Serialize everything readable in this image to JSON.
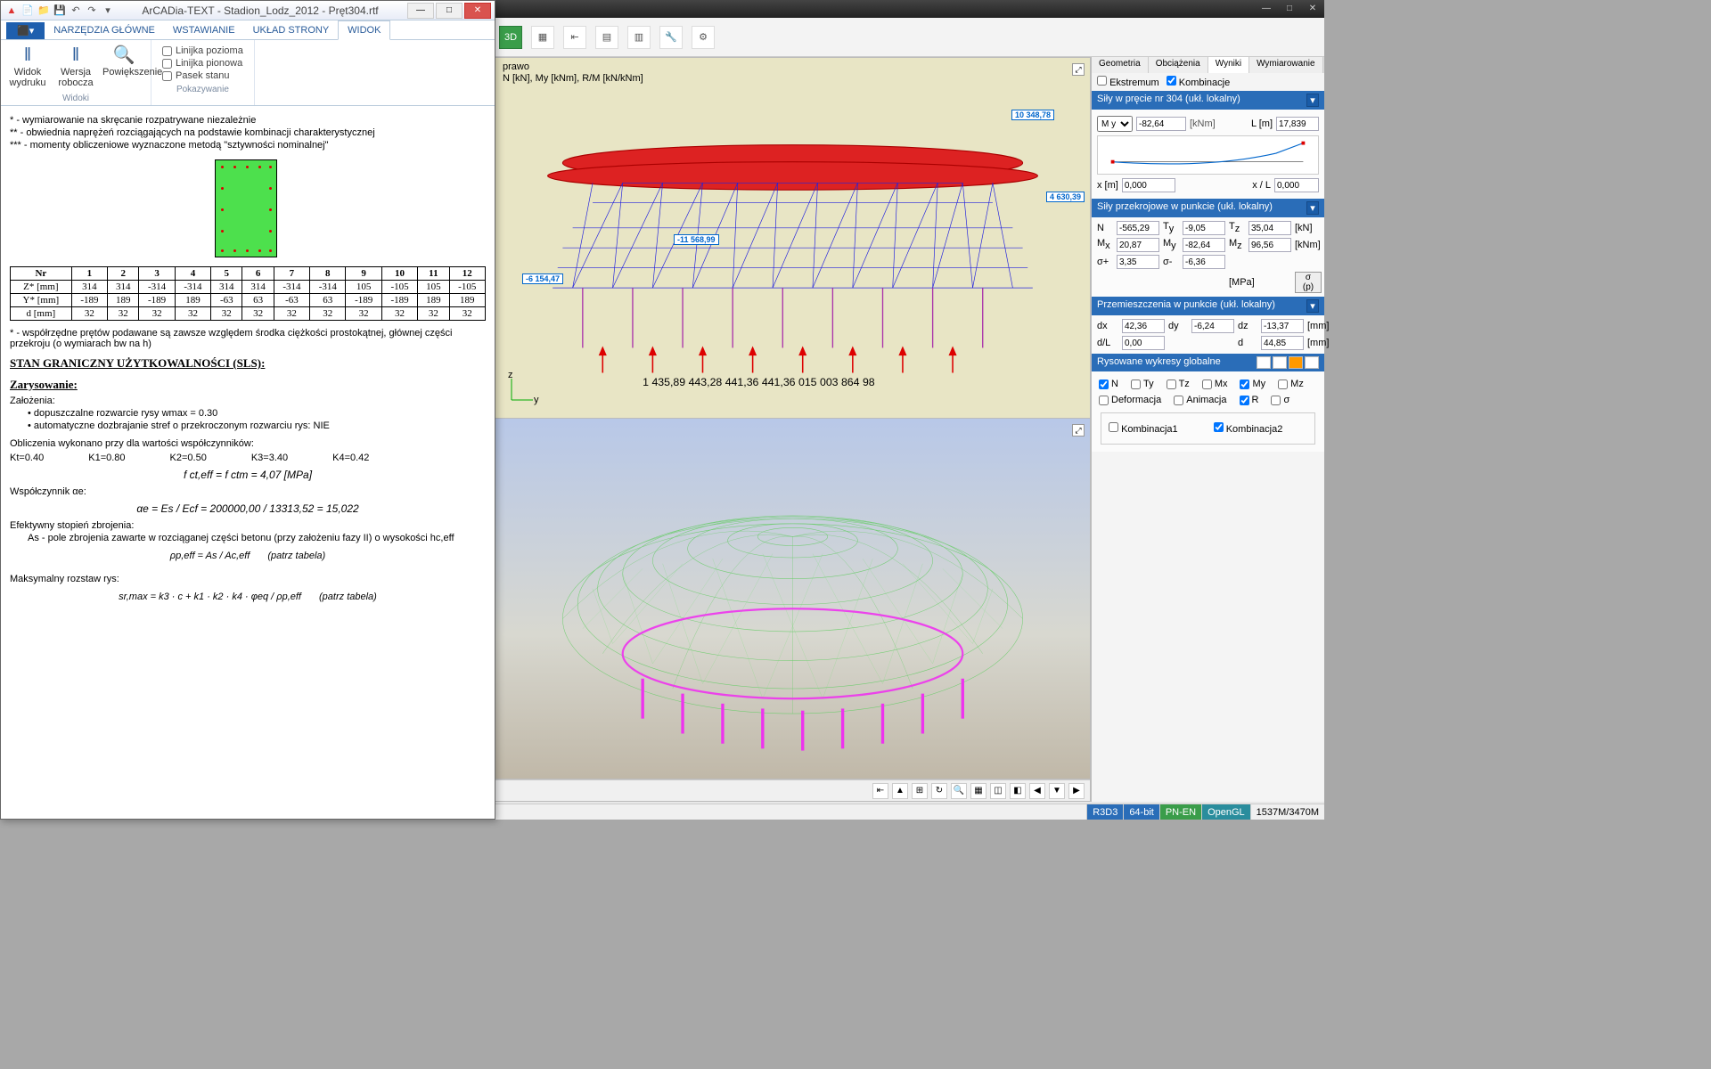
{
  "arcadia": {
    "title": "ArCADia-TEXT - Stadion_Lodz_2012 - Pręt304.rtf",
    "tabs": {
      "file": "⬛▾",
      "narzedzia": "NARZĘDZIA GŁÓWNE",
      "wstawianie": "WSTAWIANIE",
      "uklad": "UKŁAD STRONY",
      "widok": "WIDOK"
    },
    "ribbon": {
      "widok_wydruku": "Widok wydruku",
      "wersja_robocza": "Wersja robocza",
      "powiekszenie": "Powiększenie",
      "widoki_label": "Widoki",
      "linijka_pozioma": "Linijka pozioma",
      "linijka_pionowa": "Linijka pionowa",
      "pasek_stanu": "Pasek stanu",
      "pokazywanie_label": "Pokazywanie"
    },
    "doc": {
      "note1": "* - wymiarowanie na skręcanie rozpatrywane niezależnie",
      "note2": "** - obwiednia naprężeń rozciągających na podstawie kombinacji charakterystycznej",
      "note3": "*** - momenty obliczeniowe wyznaczone metodą \"sztywności nominalnej\"",
      "table": {
        "headers": [
          "Nr",
          "1",
          "2",
          "3",
          "4",
          "5",
          "6",
          "7",
          "8",
          "9",
          "10",
          "11",
          "12"
        ],
        "rows": [
          [
            "Z* [mm]",
            "314",
            "314",
            "-314",
            "-314",
            "314",
            "314",
            "-314",
            "-314",
            "105",
            "-105",
            "105",
            "-105"
          ],
          [
            "Y* [mm]",
            "-189",
            "189",
            "-189",
            "189",
            "-63",
            "63",
            "-63",
            "63",
            "-189",
            "-189",
            "189",
            "189"
          ],
          [
            "d [mm]",
            "32",
            "32",
            "32",
            "32",
            "32",
            "32",
            "32",
            "32",
            "32",
            "32",
            "32",
            "32"
          ]
        ]
      },
      "note4": "* - współrzędne prętów podawane są zawsze względem środka ciężkości prostokątnej, głównej części przekroju (o wymiarach bw na h)",
      "sls_heading": "STAN GRANICZNY UŻYTKOWALNOŚCI (SLS):",
      "zarysowanie": "Zarysowanie:",
      "zalozenia": "Założenia:",
      "assum1": "dopuszczalne rozwarcie rysy wmax = 0.30",
      "assum2": "automatyczne dozbrajanie stref o przekroczonym rozwarciu rys: NIE",
      "coef_intro": "Obliczenia wykonano przy dla wartości współczynników:",
      "coefs": {
        "k1": "Kt=0.40",
        "k2": "K1=0.80",
        "k3": "K2=0.50",
        "k4": "K3=3.40",
        "k5": "K4=0.42"
      },
      "formula1": "f ct,eff = f ctm = 4,07 [MPa]",
      "alpha_label": "Współczynnik αe:",
      "formula2": "αe = Es / Ecf = 200000,00 / 13313,52 = 15,022",
      "eff_label": "Efektywny stopień zbrojenia:",
      "eff_desc": "As - pole zbrojenia zawarte w rozciąganej części betonu (przy założeniu fazy II) o wysokości hc,eff",
      "formula3": "ρp,eff = As / Ac,eff",
      "patrz": "(patrz tabela)",
      "max_label": "Maksymalny rozstaw rys:",
      "formula4": "sr,max = k3 · c + k1 · k2 · k4 · φeq / ρp,eff"
    }
  },
  "viewport": {
    "top_label1": "prawo",
    "top_label2": "N [kN], My [kNm], R/M [kN/kNm]",
    "axis_z": "z",
    "axis_y": "y",
    "tags": {
      "t1": "10 348,78",
      "t2": "4 630,39",
      "t3": "-11 568,99",
      "t4": "-6 154,47"
    }
  },
  "panel": {
    "tabs": {
      "geometria": "Geometria",
      "obciazenia": "Obciążenia",
      "wyniki": "Wyniki",
      "wymiarowanie": "Wymiarowanie"
    },
    "ekstremum": "Ekstremum",
    "kombinacje": "Kombinacje",
    "sily_header": "Siły w pręcie nr 304 (ukł. lokalny)",
    "My_val": "-82,64",
    "kNm": "[kNm]",
    "L_lbl": "L [m]",
    "L_val": "17,839",
    "x_lbl": "x [m]",
    "x_val": "0,000",
    "xL_lbl": "x / L",
    "xL_val": "0,000",
    "przekroj_header": "Siły przekrojowe w punkcie (ukł. lokalny)",
    "N": "-565,29",
    "Ty": "-9,05",
    "Tz": "35,04",
    "Mx": "20,87",
    "My": "-82,64",
    "Mz": "96,56",
    "sp": "3,35",
    "sm": "-6,36",
    "sigma_btn": "σ (p)",
    "kN": "[kN]",
    "MPa": "[MPa]",
    "przem_header": "Przemieszczenia w punkcie (ukł. lokalny)",
    "dx": "42,36",
    "dy": "-6,24",
    "dz": "-13,37",
    "dL": "0,00",
    "dblank": "44,85",
    "mm": "[mm]",
    "wykresy_header": "Rysowane wykresy globalne",
    "chk": {
      "N": "N",
      "Ty": "Ty",
      "Tz": "Tz",
      "Mx": "Mx",
      "My": "My",
      "Mz": "Mz",
      "Deformacja": "Deformacja",
      "Animacja": "Animacja",
      "R": "R",
      "sigma": "σ",
      "Kombinacja1": "Kombinacja1",
      "Kombinacja2": "Kombinacja2"
    }
  },
  "status": {
    "r3d3": "R3D3",
    "bits": "64-bit",
    "pnen": "PN-EN",
    "opengl": "OpenGL",
    "mem": "1537M/3470M"
  }
}
